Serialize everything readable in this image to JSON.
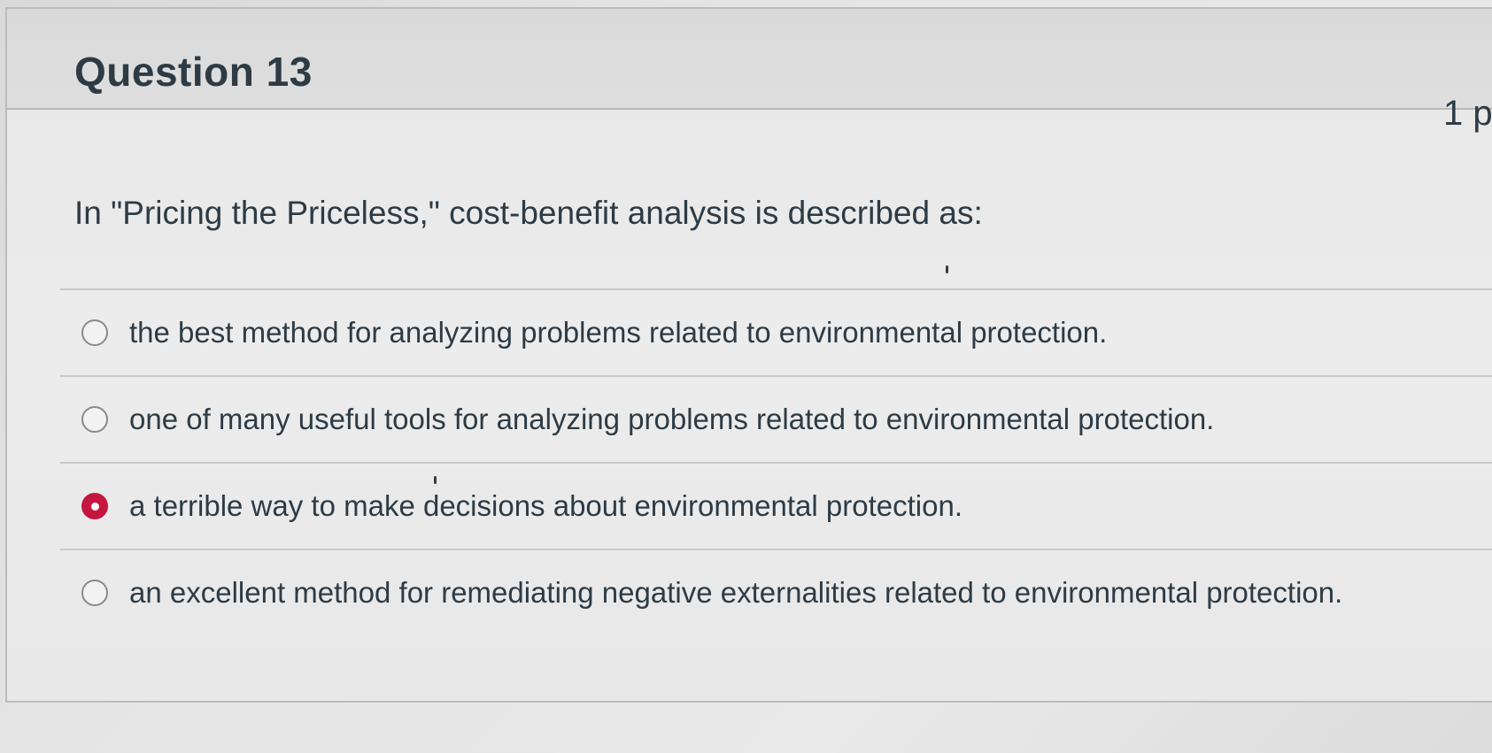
{
  "question": {
    "title": "Question 13",
    "points": "1 p",
    "text": "In \"Pricing the Priceless,\" cost-benefit analysis is described as:"
  },
  "answers": [
    {
      "label": "the best method for analyzing problems related to environmental protection.",
      "selected": false
    },
    {
      "label": "one of many useful tools for analyzing problems related to environmental protection.",
      "selected": false
    },
    {
      "label": "a terrible way to make decisions about environmental protection.",
      "selected": true
    },
    {
      "label": "an excellent method for remediating negative externalities related to environmental protection.",
      "selected": false
    }
  ],
  "colors": {
    "selected_radio": "#c5163f",
    "text": "#2d3b45"
  }
}
